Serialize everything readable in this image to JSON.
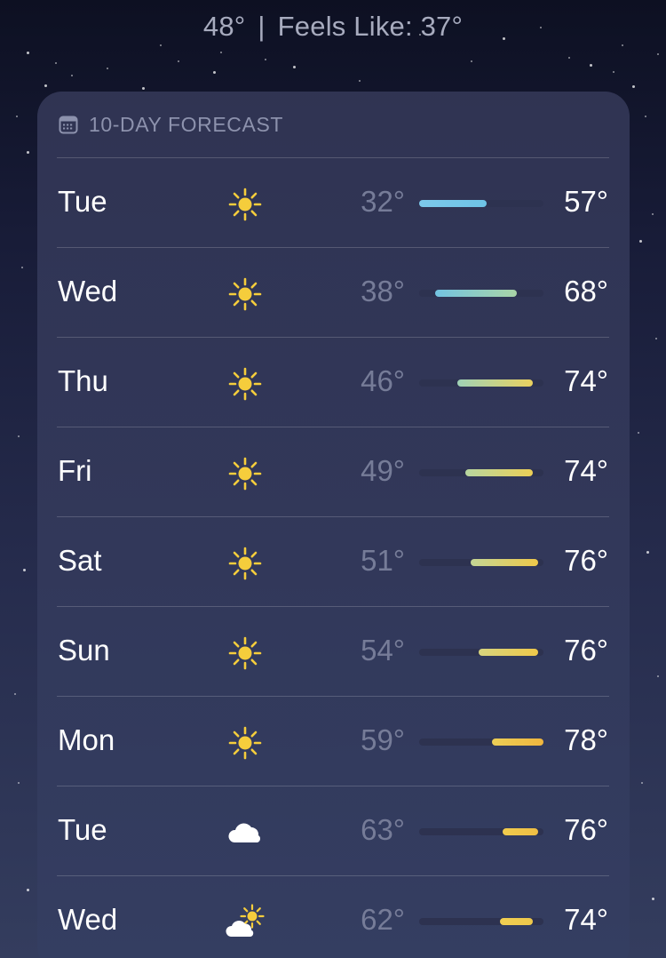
{
  "current": {
    "temp": "48°",
    "separator": "|",
    "feels_like": "Feels Like: 37°"
  },
  "forecast": {
    "title": "10-DAY FORECAST",
    "header_icon": "calendar-icon",
    "range_min": 32,
    "range_max": 78,
    "days": [
      {
        "day": "Tue",
        "icon": "sun-icon",
        "low": "32°",
        "high": "57°",
        "low_val": 32,
        "high_val": 57,
        "color_start": "#7cc9eb",
        "color_end": "#6ec3e6"
      },
      {
        "day": "Wed",
        "icon": "sun-icon",
        "low": "38°",
        "high": "68°",
        "low_val": 38,
        "high_val": 68,
        "color_start": "#73c4e2",
        "color_end": "#a9d4a6"
      },
      {
        "day": "Thu",
        "icon": "sun-icon",
        "low": "46°",
        "high": "74°",
        "low_val": 46,
        "high_val": 74,
        "color_start": "#9fd2b6",
        "color_end": "#ead15f"
      },
      {
        "day": "Fri",
        "icon": "sun-icon",
        "low": "49°",
        "high": "74°",
        "low_val": 49,
        "high_val": 74,
        "color_start": "#b7d6a0",
        "color_end": "#eccf56"
      },
      {
        "day": "Sat",
        "icon": "sun-icon",
        "low": "51°",
        "high": "76°",
        "low_val": 51,
        "high_val": 76,
        "color_start": "#c4d695",
        "color_end": "#efc94a"
      },
      {
        "day": "Sun",
        "icon": "sun-icon",
        "low": "54°",
        "high": "76°",
        "low_val": 54,
        "high_val": 76,
        "color_start": "#d7d47e",
        "color_end": "#efc94a"
      },
      {
        "day": "Mon",
        "icon": "sun-icon",
        "low": "59°",
        "high": "78°",
        "low_val": 59,
        "high_val": 78,
        "color_start": "#ecce56",
        "color_end": "#f0b63e"
      },
      {
        "day": "Tue",
        "icon": "cloud-icon",
        "low": "63°",
        "high": "76°",
        "low_val": 63,
        "high_val": 76,
        "color_start": "#f1cc4e",
        "color_end": "#efbe43"
      },
      {
        "day": "Wed",
        "icon": "partly-cloudy-icon",
        "low": "62°",
        "high": "74°",
        "low_val": 62,
        "high_val": 74,
        "color_start": "#f1cf52",
        "color_end": "#eec84b"
      }
    ]
  },
  "colors": {
    "sun": "#f5cd3c",
    "cloud": "#ffffff",
    "low_text": "#767c98",
    "high_text": "#ffffff"
  }
}
